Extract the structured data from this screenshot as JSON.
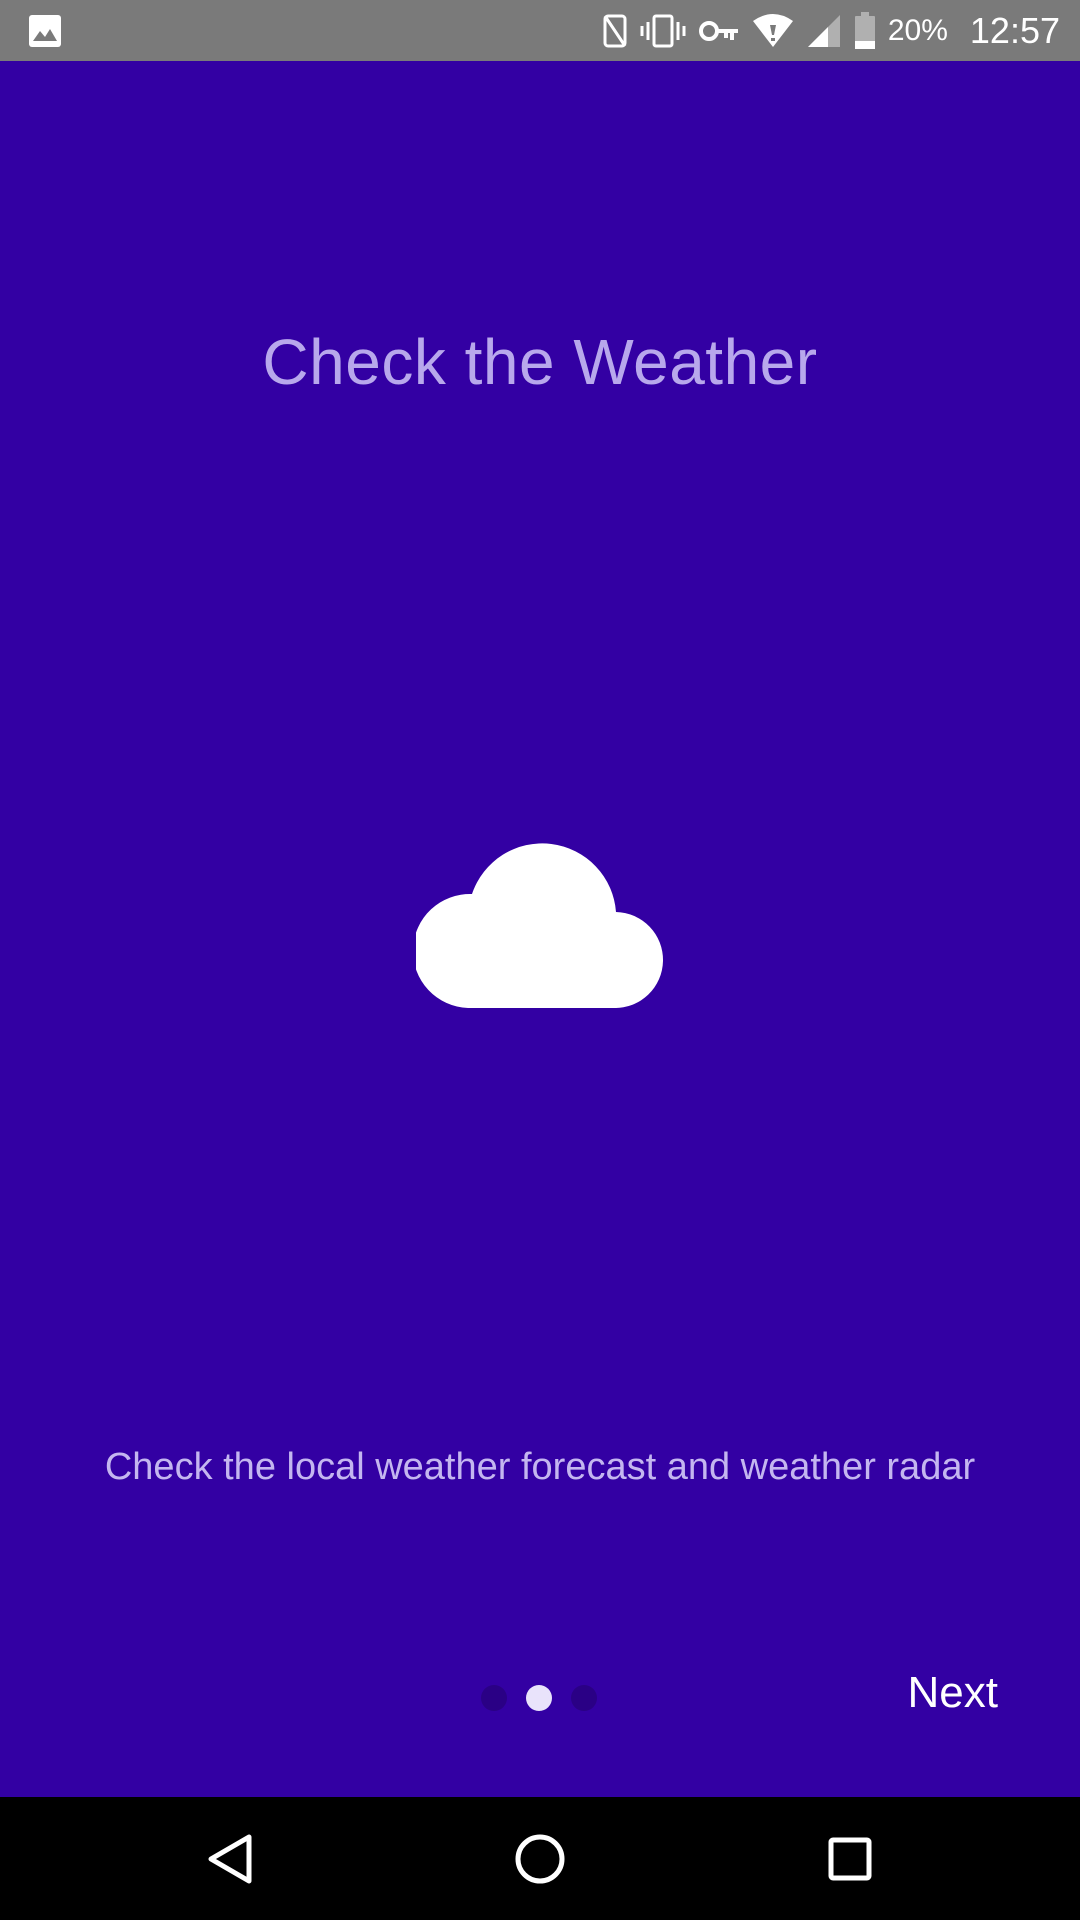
{
  "status_bar": {
    "left_icon": "image-icon",
    "icons": [
      "nfc-icon",
      "vibrate-icon",
      "vpn-key-icon",
      "wifi-icon",
      "cell-signal-icon",
      "battery-icon"
    ],
    "battery_percent": "20%",
    "time": "12:57"
  },
  "onboarding": {
    "title": "Check the Weather",
    "illustration": "cloud-icon",
    "description": "Check the local weather forecast and weather radar",
    "page_indicator": {
      "count": 3,
      "active_index": 1
    },
    "next_label": "Next"
  },
  "nav_bar": {
    "buttons": [
      "back-icon",
      "home-icon",
      "recents-icon"
    ]
  },
  "colors": {
    "background": "#3300a3",
    "title_text": "#b8a8ec",
    "description_text": "#c4b6f0",
    "dot_active": "#e9e3fb",
    "dot_inactive": "#2a0085",
    "status_bar": "#7a7a7a",
    "nav_bar": "#000000"
  }
}
